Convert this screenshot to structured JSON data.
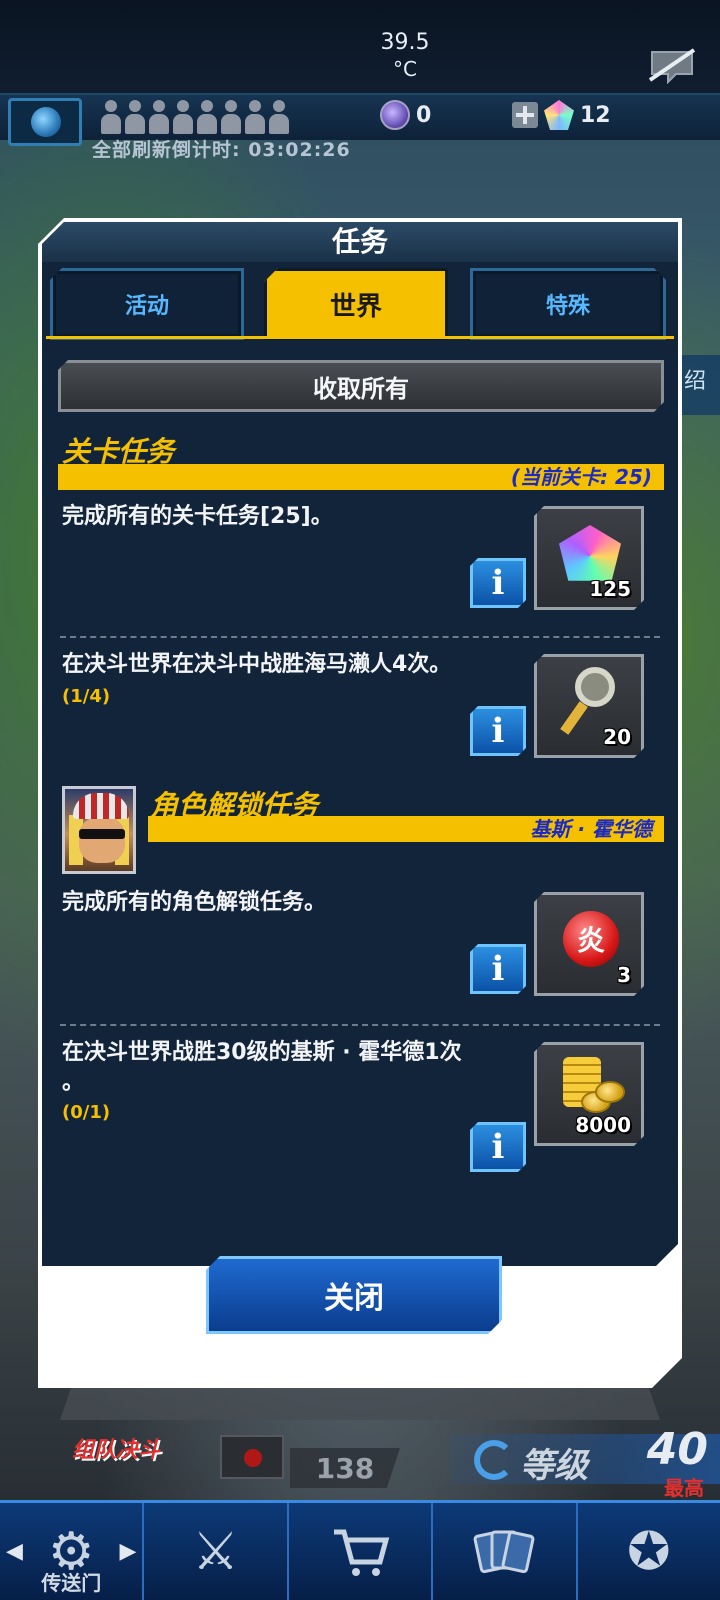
{
  "status": {
    "temperature": "39.5",
    "temperature_unit": "°C"
  },
  "resources": {
    "orb_count": "0",
    "gem_count": "12",
    "refresh_countdown": "全部刷新倒计时: 03:02:26"
  },
  "side_tab_label": "绍",
  "modal": {
    "title": "任务",
    "tabs": [
      {
        "label": "活动",
        "active": false
      },
      {
        "label": "世界",
        "active": true
      },
      {
        "label": "特殊",
        "active": false
      }
    ],
    "collect_all_label": "收取所有",
    "sections": [
      {
        "title": "关卡任务",
        "subtitle": "(当前关卡: 25)",
        "missions": [
          {
            "text": "完成所有的关卡任务[25]。",
            "progress": "",
            "reward_icon": "gem-icon",
            "reward_count": "125"
          },
          {
            "text": "在决斗世界在决斗中战胜海马濑人4次。",
            "progress": "(1/4)",
            "reward_icon": "key-icon",
            "reward_count": "20"
          }
        ]
      },
      {
        "title": "角色解锁任务",
        "subtitle": "基斯 · 霍华德",
        "missions": [
          {
            "text": "完成所有的角色解锁任务。",
            "progress": "",
            "reward_icon": "flame-orb-icon",
            "reward_count": "3"
          },
          {
            "text": "在决斗世界战胜30级的基斯 · 霍华德1次\n。",
            "progress": "(0/1)",
            "reward_icon": "gold-coins-icon",
            "reward_count": "8000"
          }
        ]
      }
    ],
    "info_label": "i",
    "flame_glyph": "炎",
    "close_label": "关闭"
  },
  "bottom": {
    "event_logo_text": "组队决斗",
    "deck_count": "138",
    "level_label": "等级",
    "level_value": "40",
    "level_max_label": "最高",
    "nav": [
      {
        "icon": "portal-icon",
        "label": "传送门"
      },
      {
        "icon": "crossed-swords-icon",
        "label": ""
      },
      {
        "icon": "shop-cart-icon",
        "label": ""
      },
      {
        "icon": "cards-icon",
        "label": ""
      },
      {
        "icon": "duelist-emblem-icon",
        "label": ""
      }
    ]
  },
  "colors": {
    "accent_yellow": "#f5c000",
    "modal_bg": "#12243a",
    "info_blue": "#0b52a8",
    "subtitle_blue": "#1c2bbf"
  }
}
